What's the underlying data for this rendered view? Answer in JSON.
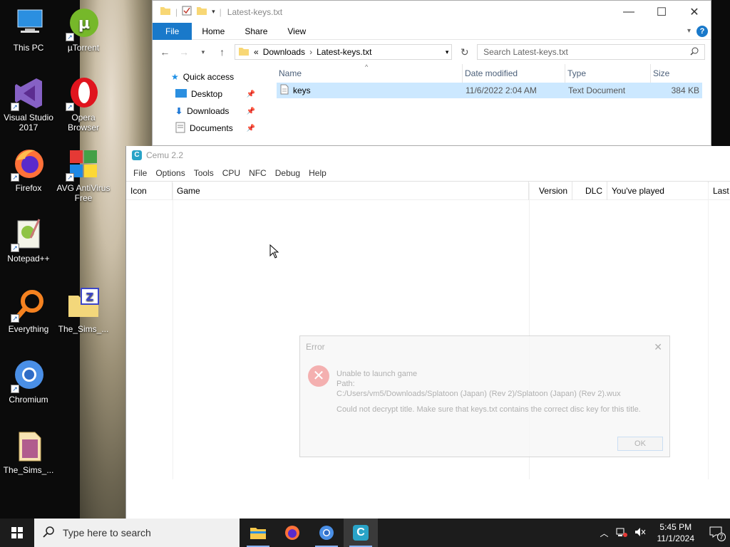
{
  "desktop": {
    "icons": [
      {
        "label": "This PC",
        "icon": "this-pc-icon"
      },
      {
        "label": "µTorrent",
        "icon": "utorrent-icon"
      },
      {
        "label": "Visual Studio 2017",
        "icon": "visual-studio-icon"
      },
      {
        "label": "Opera Browser",
        "icon": "opera-icon"
      },
      {
        "label": "Firefox",
        "icon": "firefox-icon"
      },
      {
        "label": "AVG AntiVirus Free",
        "icon": "avg-icon"
      },
      {
        "label": "Notepad++",
        "icon": "notepadpp-icon"
      },
      {
        "label": "Everything",
        "icon": "everything-icon"
      },
      {
        "label": "The_Sims_...",
        "icon": "zip-folder-icon"
      },
      {
        "label": "Chromium",
        "icon": "chromium-icon"
      },
      {
        "label": "The_Sims_...",
        "icon": "sims-file-icon"
      }
    ]
  },
  "explorer": {
    "title": "Latest-keys.txt",
    "ribbon_tabs": [
      "File",
      "Home",
      "Share",
      "View"
    ],
    "breadcrumb": {
      "prefix": "«",
      "parts": [
        "Downloads",
        "Latest-keys.txt"
      ]
    },
    "search_placeholder": "Search Latest-keys.txt",
    "nav": [
      {
        "label": "Quick access",
        "icon": "star-icon"
      },
      {
        "label": "Desktop",
        "icon": "desktop-icon"
      },
      {
        "label": "Downloads",
        "icon": "download-icon"
      },
      {
        "label": "Documents",
        "icon": "documents-icon"
      }
    ],
    "columns": [
      "Name",
      "Date modified",
      "Type",
      "Size"
    ],
    "files": [
      {
        "name": "keys",
        "date": "11/6/2022 2:04 AM",
        "type": "Text Document",
        "size": "384 KB"
      }
    ]
  },
  "cemu": {
    "title": "Cemu 2.2",
    "menu": [
      "File",
      "Options",
      "Tools",
      "CPU",
      "NFC",
      "Debug",
      "Help"
    ],
    "columns": [
      "Icon",
      "Game",
      "Version",
      "DLC",
      "You've played",
      "Last p"
    ]
  },
  "dialog": {
    "title": "Error",
    "line1": "Unable to launch game",
    "line2": "Path:",
    "line3": "C:/Users/vm5/Downloads/Splatoon (Japan) (Rev 2)/Splatoon (Japan) (Rev 2).wux",
    "line4": "Could not decrypt title. Make sure that keys.txt contains the correct disc key for this title.",
    "ok": "OK"
  },
  "taskbar": {
    "search_placeholder": "Type here to search",
    "apps": [
      "file-explorer-icon",
      "firefox-icon",
      "chromium-icon",
      "cemu-icon"
    ],
    "time": "5:45 PM",
    "date": "11/1/2024",
    "notification_count": "7"
  }
}
